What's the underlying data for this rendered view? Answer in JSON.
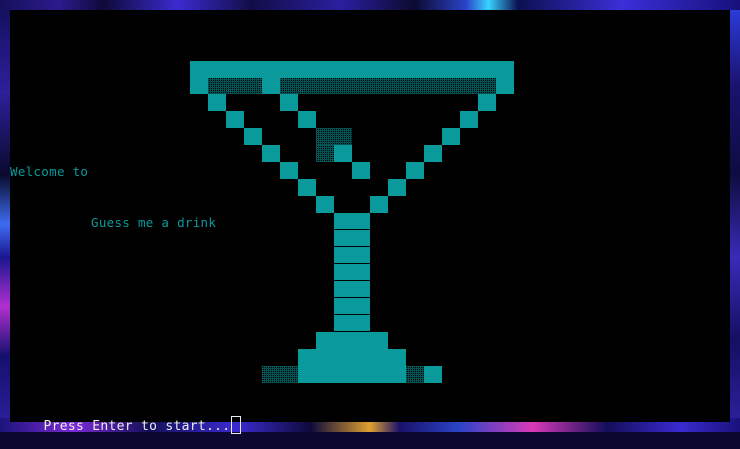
{
  "terminal": {
    "welcome_line": "Welcome to",
    "title_line": "Guess me a drink",
    "prompt": "Press Enter to start..."
  },
  "art": {
    "name": "martini-glass-ascii",
    "color": "#0a9a9c"
  },
  "colors": {
    "text_accent": "#0a9a9c",
    "prompt_text": "#ececec",
    "terminal_bg": "#000000"
  }
}
